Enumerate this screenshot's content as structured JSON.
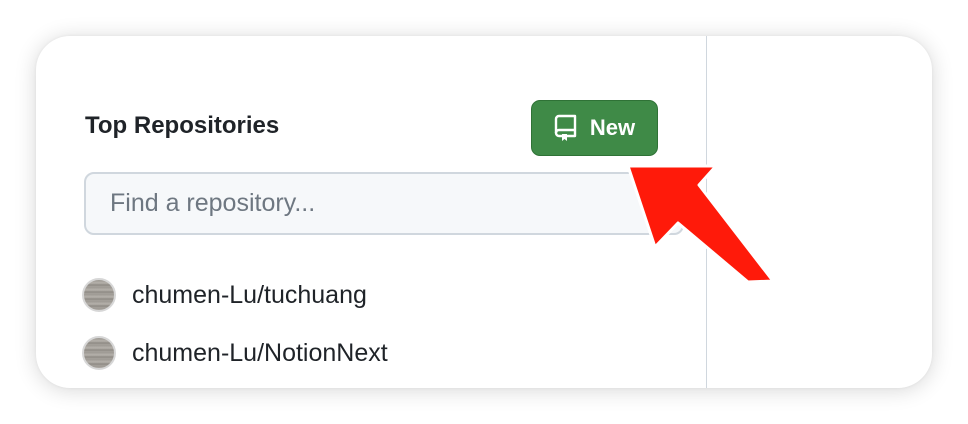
{
  "section": {
    "title": "Top Repositories"
  },
  "new_button": {
    "label": "New",
    "icon": "repo-icon",
    "color": "#3f8a47"
  },
  "search": {
    "placeholder": "Find a repository...",
    "value": ""
  },
  "repositories": [
    {
      "name": "chumen-Lu/tuchuang",
      "avatar": "user-avatar"
    },
    {
      "name": "chumen-Lu/NotionNext",
      "avatar": "user-avatar"
    }
  ],
  "annotation": {
    "icon": "red-arrow-pointer",
    "color": "#ff1a0a"
  }
}
